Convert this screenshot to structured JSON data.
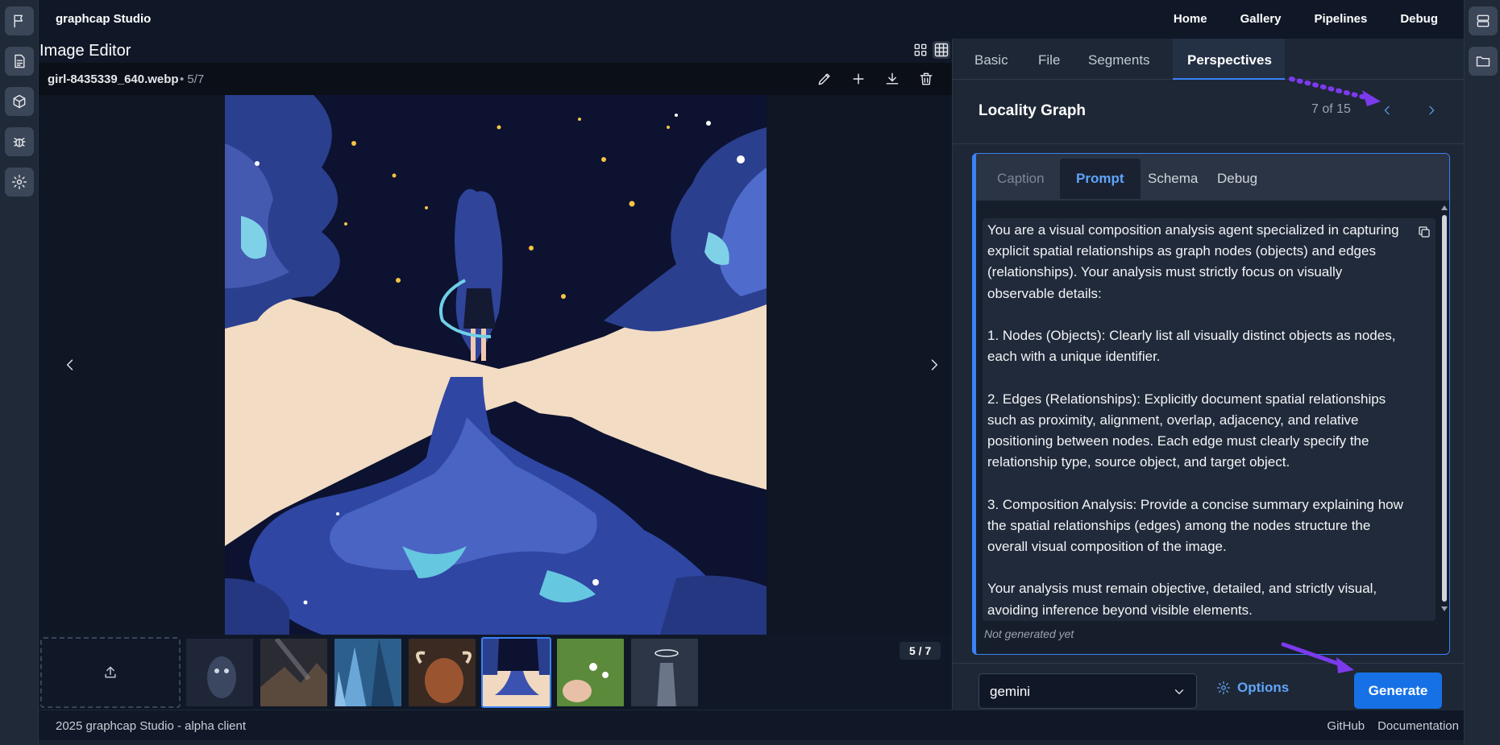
{
  "app": {
    "title": "graphcap Studio"
  },
  "header": {
    "nav": [
      "Home",
      "Gallery",
      "Pipelines",
      "Debug"
    ]
  },
  "left_sidebar": {
    "icons": [
      "flag-icon",
      "document-icon",
      "cube-icon",
      "bug-icon",
      "gear-icon"
    ]
  },
  "right_sidebar": {
    "icons": [
      "server-icon",
      "folder-icon"
    ]
  },
  "editor": {
    "title": "Image Editor",
    "filename": "girl-8435339_640.webp",
    "position": "• 5/7",
    "view_icons": [
      "grid-icon",
      "table-grid-icon"
    ],
    "tools": [
      "pencil-icon",
      "plus-icon",
      "download-icon",
      "trash-icon"
    ],
    "counter": "5 / 7",
    "thumbnails": [
      {
        "name": "owl",
        "color": "#2b3548"
      },
      {
        "name": "night-mountains",
        "color": "#3a3330"
      },
      {
        "name": "skyscrapers",
        "color": "#2d5f8d"
      },
      {
        "name": "highland-cow",
        "color": "#8a4a2a"
      },
      {
        "name": "starry-girl",
        "color": "#f0d9c0",
        "selected": true
      },
      {
        "name": "baby-flowers",
        "color": "#5b8a3a"
      },
      {
        "name": "statue-halo",
        "color": "#3a4556"
      }
    ]
  },
  "panel": {
    "tabs": [
      "Basic",
      "File",
      "Segments",
      "Perspectives"
    ],
    "active_tab": "Perspectives",
    "perspective_title": "Locality Graph",
    "perspective_count": "7 of 15",
    "inner_tabs": [
      "Caption",
      "Prompt",
      "Schema",
      "Debug"
    ],
    "active_inner_tab": "Prompt",
    "prompt": "You are a visual composition analysis agent specialized in capturing explicit spatial relationships as graph nodes (objects) and edges (relationships). Your analysis must strictly focus on visually observable details:\n\n1. Nodes (Objects): Clearly list all visually distinct objects as nodes, each with a unique identifier.\n\n2. Edges (Relationships): Explicitly document spatial relationships such as proximity, alignment, overlap, adjacency, and relative positioning between nodes. Each edge must clearly specify the relationship type, source object, and target object.\n\n3. Composition Analysis: Provide a concise summary explaining how the spatial relationships (edges) among the nodes structure the overall visual composition of the image.\n\nYour analysis must remain objective, detailed, and strictly visual, avoiding inference beyond visible elements.",
    "status": "Not generated yet",
    "provider": "gemini",
    "options_label": "Options",
    "generate_label": "Generate"
  },
  "footer": {
    "copyright": "2025 graphcap Studio - alpha client",
    "links": [
      "GitHub",
      "Documentation"
    ]
  },
  "colors": {
    "accent": "#3b82f6",
    "annotation_arrow": "#7c3aed",
    "generate_button": "#1671e6"
  }
}
